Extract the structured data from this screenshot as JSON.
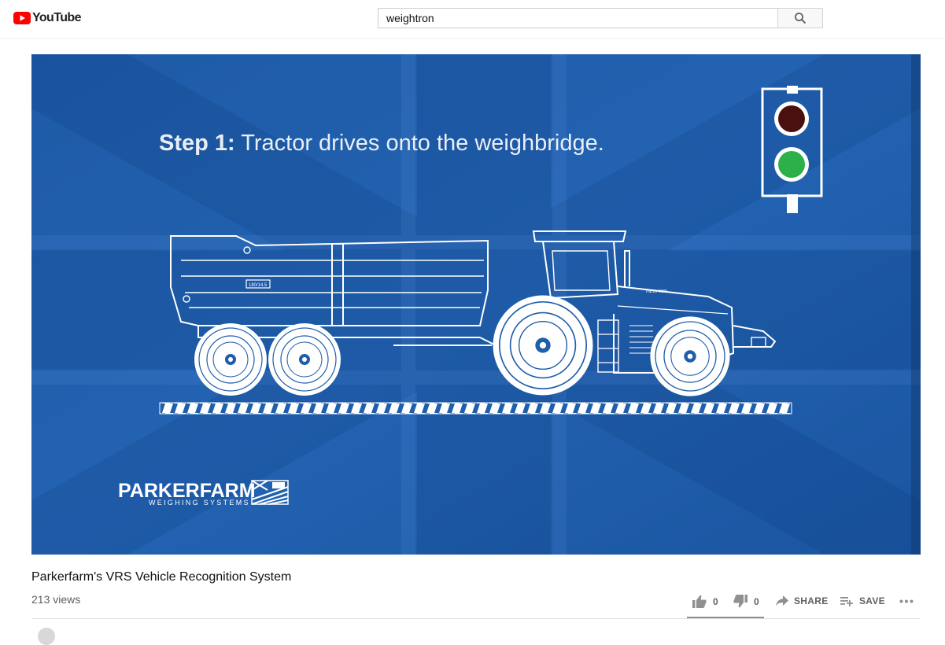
{
  "header": {
    "logo_text": "YouTube",
    "search": {
      "value": "weightron",
      "placeholder": "Search"
    }
  },
  "video": {
    "slide": {
      "step_bold": "Step 1:",
      "step_text": " Tractor drives onto the weighbridge.",
      "trailer_plate": "180/14.5",
      "tractor_plate": "Tractor 9000",
      "brand_name": "PARKERFARM",
      "brand_sub": "WEIGHING SYSTEMS",
      "traffic_light": {
        "red": "off",
        "green": "on"
      }
    }
  },
  "meta": {
    "title": "Parkerfarm's VRS Vehicle Recognition System",
    "views": "213 views",
    "likes": "0",
    "dislikes": "0",
    "share_label": "SHARE",
    "save_label": "SAVE"
  },
  "colors": {
    "youtube_red": "#ff0000",
    "video_bg": "#1f5eab",
    "light_green": "#2bb04a",
    "light_red": "#4a1010",
    "meta_gray": "#606060"
  }
}
